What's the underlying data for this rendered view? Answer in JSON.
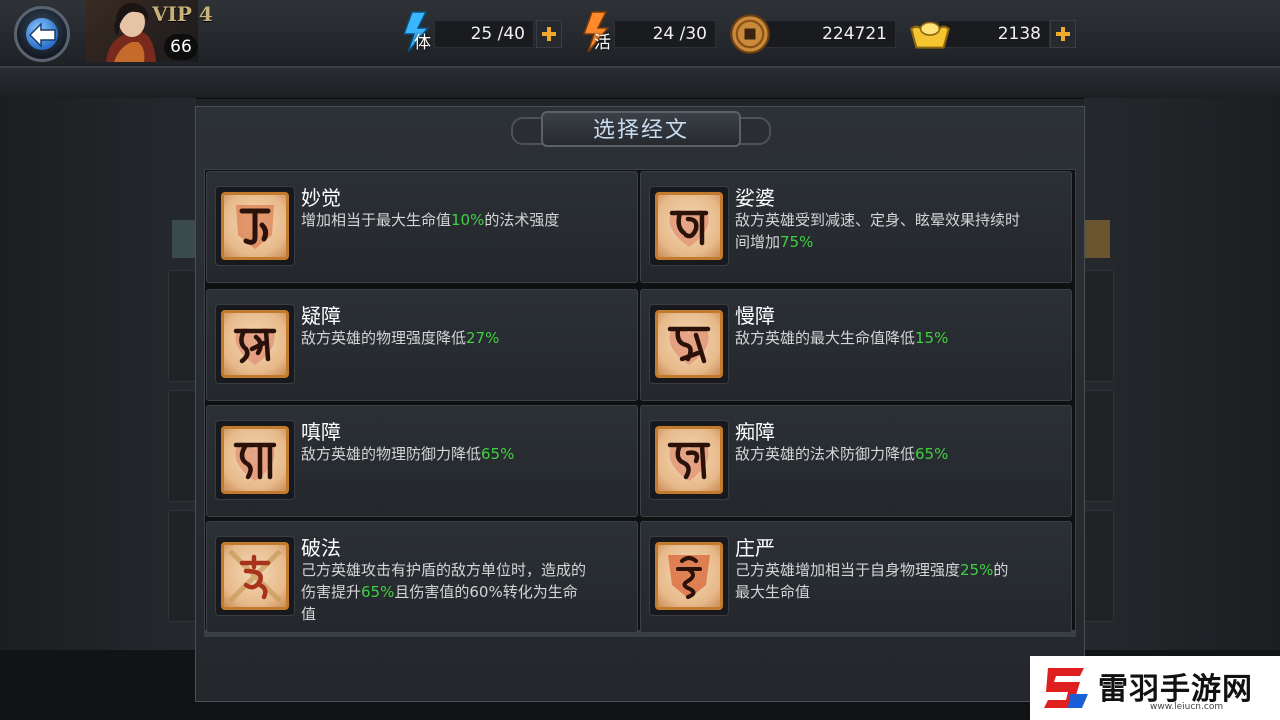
{
  "player": {
    "vip": "VIP 4",
    "level": "66"
  },
  "resources": {
    "stamina": {
      "char": "体",
      "value": "25 /40"
    },
    "vigor": {
      "char": "活",
      "value": "24 /30"
    },
    "coins": {
      "value": "224721"
    },
    "ingots": {
      "value": "2138"
    }
  },
  "dialog": {
    "title": "选择经文",
    "scriptures": [
      {
        "name": "妙觉",
        "desc_pre": "增加相当于最大生命值",
        "desc_hl": "10%",
        "desc_post": "的法术强度"
      },
      {
        "name": "娑婆",
        "desc_pre": "敌方英雄受到减速、定身、眩晕效果持续时间增加",
        "desc_hl": "75%",
        "desc_post": ""
      },
      {
        "name": "疑障",
        "desc_pre": "敌方英雄的物理强度降低",
        "desc_hl": "27%",
        "desc_post": ""
      },
      {
        "name": "慢障",
        "desc_pre": "敌方英雄的最大生命值降低",
        "desc_hl": "15%",
        "desc_post": ""
      },
      {
        "name": "嗔障",
        "desc_pre": "敌方英雄的物理防御力降低",
        "desc_hl": "65%",
        "desc_post": ""
      },
      {
        "name": "痴障",
        "desc_pre": "敌方英雄的法术防御力降低",
        "desc_hl": "65%",
        "desc_post": ""
      },
      {
        "name": "破法",
        "desc_pre": "己方英雄攻击有护盾的敌方单位时，造成的伤害提升",
        "desc_hl": "65%",
        "desc_post": "且伤害值的60%转化为生命值"
      },
      {
        "name": "庄严",
        "desc_pre": "己方英雄增加相当于自身物理强度",
        "desc_hl": "25%",
        "desc_post": "的最大生命值"
      }
    ]
  },
  "watermark": {
    "text": "雷羽手游网",
    "url": "www.leiucn.com"
  },
  "colors": {
    "highlight": "#3fd03f",
    "accent_gold": "#f0a92a",
    "title": "#c9dcef"
  },
  "icons": {
    "back": "back-arrow-icon",
    "stamina": "lightning-blue-icon",
    "vigor": "lightning-orange-icon",
    "coins": "copper-coin-icon",
    "ingots": "gold-ingot-icon",
    "add": "plus-icon"
  }
}
